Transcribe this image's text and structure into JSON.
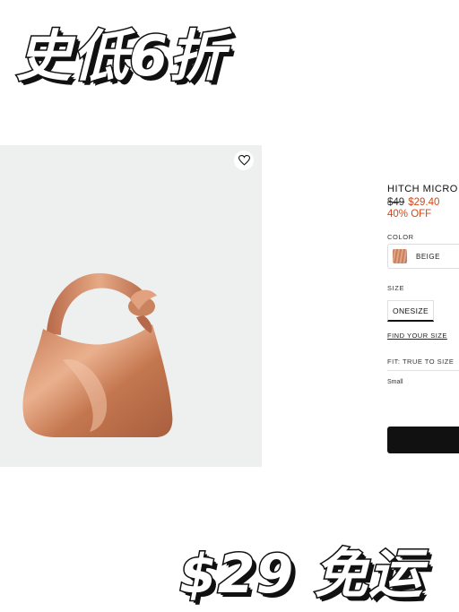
{
  "promo": {
    "top_text": "史低6折",
    "bottom_text": "$29 免运"
  },
  "product": {
    "title": "HITCH MICRO C",
    "price_old": "$49",
    "price_new": "$29.40",
    "discount": "40% OFF",
    "image_alt_icon": "handbag-image",
    "accent_color": "#d1481a"
  },
  "color": {
    "label": "COLOR",
    "selected": "BEIGE"
  },
  "size": {
    "label": "SIZE",
    "selected": "ONESIZE"
  },
  "links": {
    "find_your_size": "FIND YOUR SIZE"
  },
  "fit": {
    "label": "FIT: TRUE TO SIZE",
    "value": "Small"
  }
}
